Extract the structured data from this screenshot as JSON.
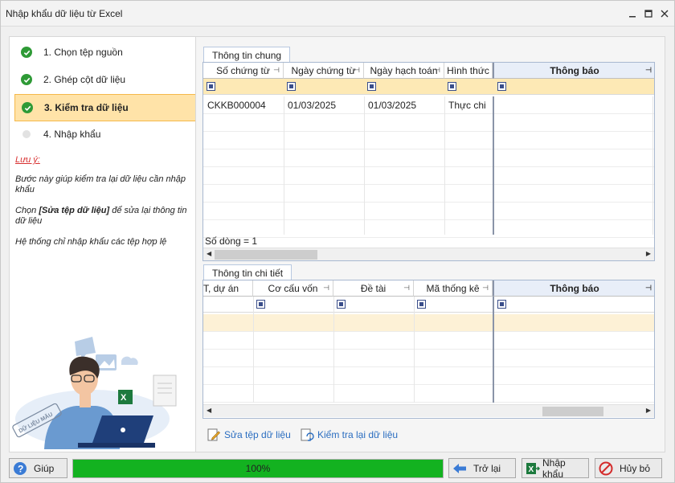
{
  "window": {
    "title": "Nhập khẩu dữ liệu từ Excel"
  },
  "steps": [
    {
      "label": "1. Chọn tệp nguồn",
      "state": "done"
    },
    {
      "label": "2. Ghép cột dữ liệu",
      "state": "done"
    },
    {
      "label": "3. Kiểm tra dữ liệu",
      "state": "active"
    },
    {
      "label": "4. Nhập khẩu",
      "state": "todo"
    }
  ],
  "note": {
    "title": "Lưu ý:",
    "line1": "Bước này giúp kiểm tra lại dữ liệu cần nhập khẩu",
    "line2_prefix": "Chọn ",
    "line2_bold": "[Sửa tệp dữ liệu]",
    "line2_suffix": " để sửa lại thông tin dữ liệu",
    "line3": "Hệ thống chỉ nhập khẩu các tệp hợp lệ"
  },
  "general": {
    "tab": "Thông tin chung",
    "columns": [
      "Số chứng từ",
      "Ngày chứng từ",
      "Ngày hạch toán",
      "Hình thức",
      "Thông báo"
    ],
    "rows": [
      [
        "CKKB000004",
        "01/03/2025",
        "01/03/2025",
        "Thực chi",
        ""
      ]
    ],
    "row_count": "Số dòng = 1"
  },
  "detail": {
    "tab": "Thông tin chi tiết",
    "columns": [
      "T, dự án",
      "Cơ cấu vốn",
      "Đề tài",
      "Mã thống kê",
      "Thông báo"
    ]
  },
  "links": {
    "edit_file": "Sửa tệp dữ liệu",
    "recheck": "Kiểm tra lại dữ liệu"
  },
  "footer": {
    "help": "Giúp",
    "progress": 100,
    "progress_text": "100%",
    "back": "Trở lại",
    "import": "Nhập khẩu",
    "cancel": "Hủy bỏ"
  },
  "illustration": {
    "stamp": "DỮ LIỆU MẪU"
  },
  "colors": {
    "accent": "#13b220",
    "active_step": "#ffe3a8",
    "filter_row": "#fde9b5",
    "link": "#2a6dc0"
  }
}
